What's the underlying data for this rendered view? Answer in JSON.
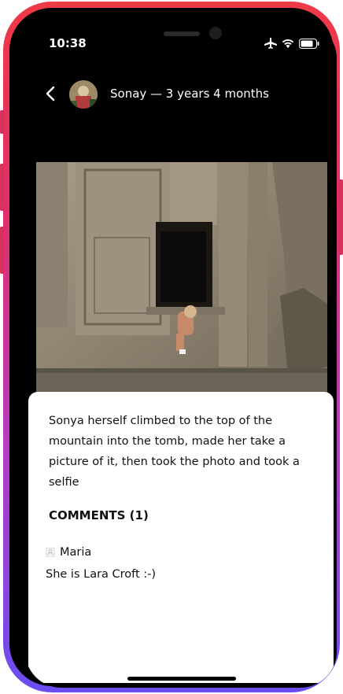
{
  "status_bar": {
    "time": "10:38"
  },
  "header": {
    "title": "Sonay — 3 years 4 months"
  },
  "post": {
    "caption": "Sonya herself climbed to the top of the mountain into the tomb, made her take a picture of it, then took the photo and took a selfie"
  },
  "comments": {
    "heading": "COMMENTS (1)",
    "items": [
      {
        "author": "Maria",
        "text": "She is Lara Croft :-)"
      }
    ]
  },
  "colors": {
    "frame_gradient_top": "#ef3a47",
    "frame_gradient_bottom": "#6b4df2",
    "screen_bg": "#000000",
    "card_bg": "#ffffff"
  }
}
